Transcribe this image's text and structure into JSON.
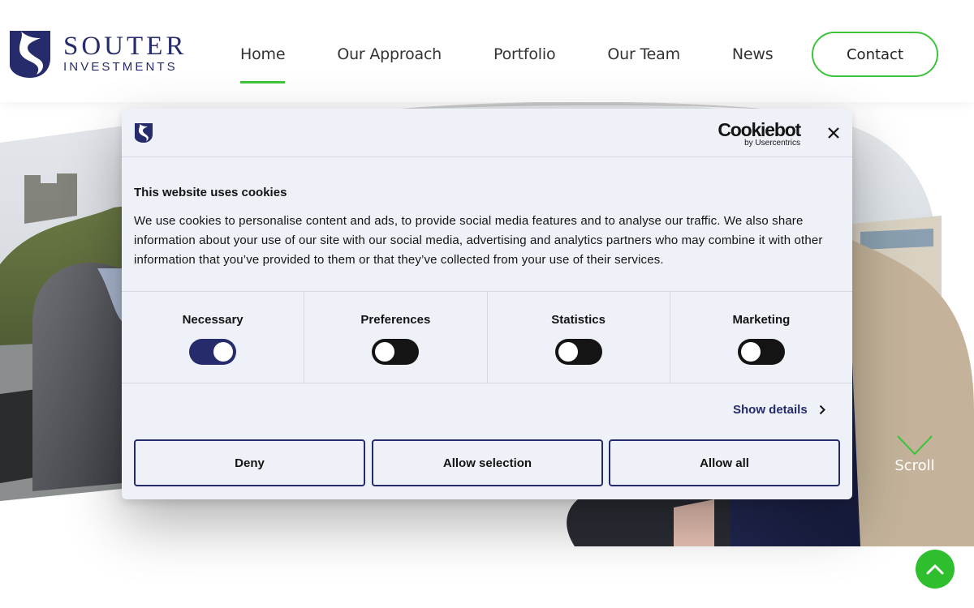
{
  "header": {
    "logo_line1": "SOUTER",
    "logo_line2": "INVESTMENTS",
    "nav": [
      {
        "label": "Home",
        "active": true
      },
      {
        "label": "Our Approach"
      },
      {
        "label": "Portfolio"
      },
      {
        "label": "Our Team"
      },
      {
        "label": "News"
      }
    ],
    "contact_label": "Contact"
  },
  "hero": {
    "scroll_label": "Scroll"
  },
  "cookie_dialog": {
    "brand": "Cookiebot",
    "brand_sub": "by Usercentrics",
    "title": "This website uses cookies",
    "text": "We use cookies to personalise content and ads, to provide social media features and to analyse our traffic. We also share information about your use of our site with our social media, advertising and analytics partners who may combine it with other information that you’ve provided to them or that they’ve collected from your use of their services.",
    "toggles": [
      {
        "label": "Necessary",
        "on": true
      },
      {
        "label": "Preferences",
        "on": false
      },
      {
        "label": "Statistics",
        "on": false
      },
      {
        "label": "Marketing",
        "on": false
      }
    ],
    "show_details_label": "Show details",
    "buttons": {
      "deny": "Deny",
      "allow_selection": "Allow selection",
      "allow_all": "Allow all"
    }
  },
  "colors": {
    "brand_navy": "#262b6b",
    "accent_green": "#3ec43c",
    "dialog_bg": "#eef1f7"
  },
  "icons": [
    "souter-logo-icon",
    "cookiebot-s-icon",
    "close-icon",
    "chevron-right-icon",
    "scroll-chevron-icon",
    "arrow-up-icon"
  ]
}
